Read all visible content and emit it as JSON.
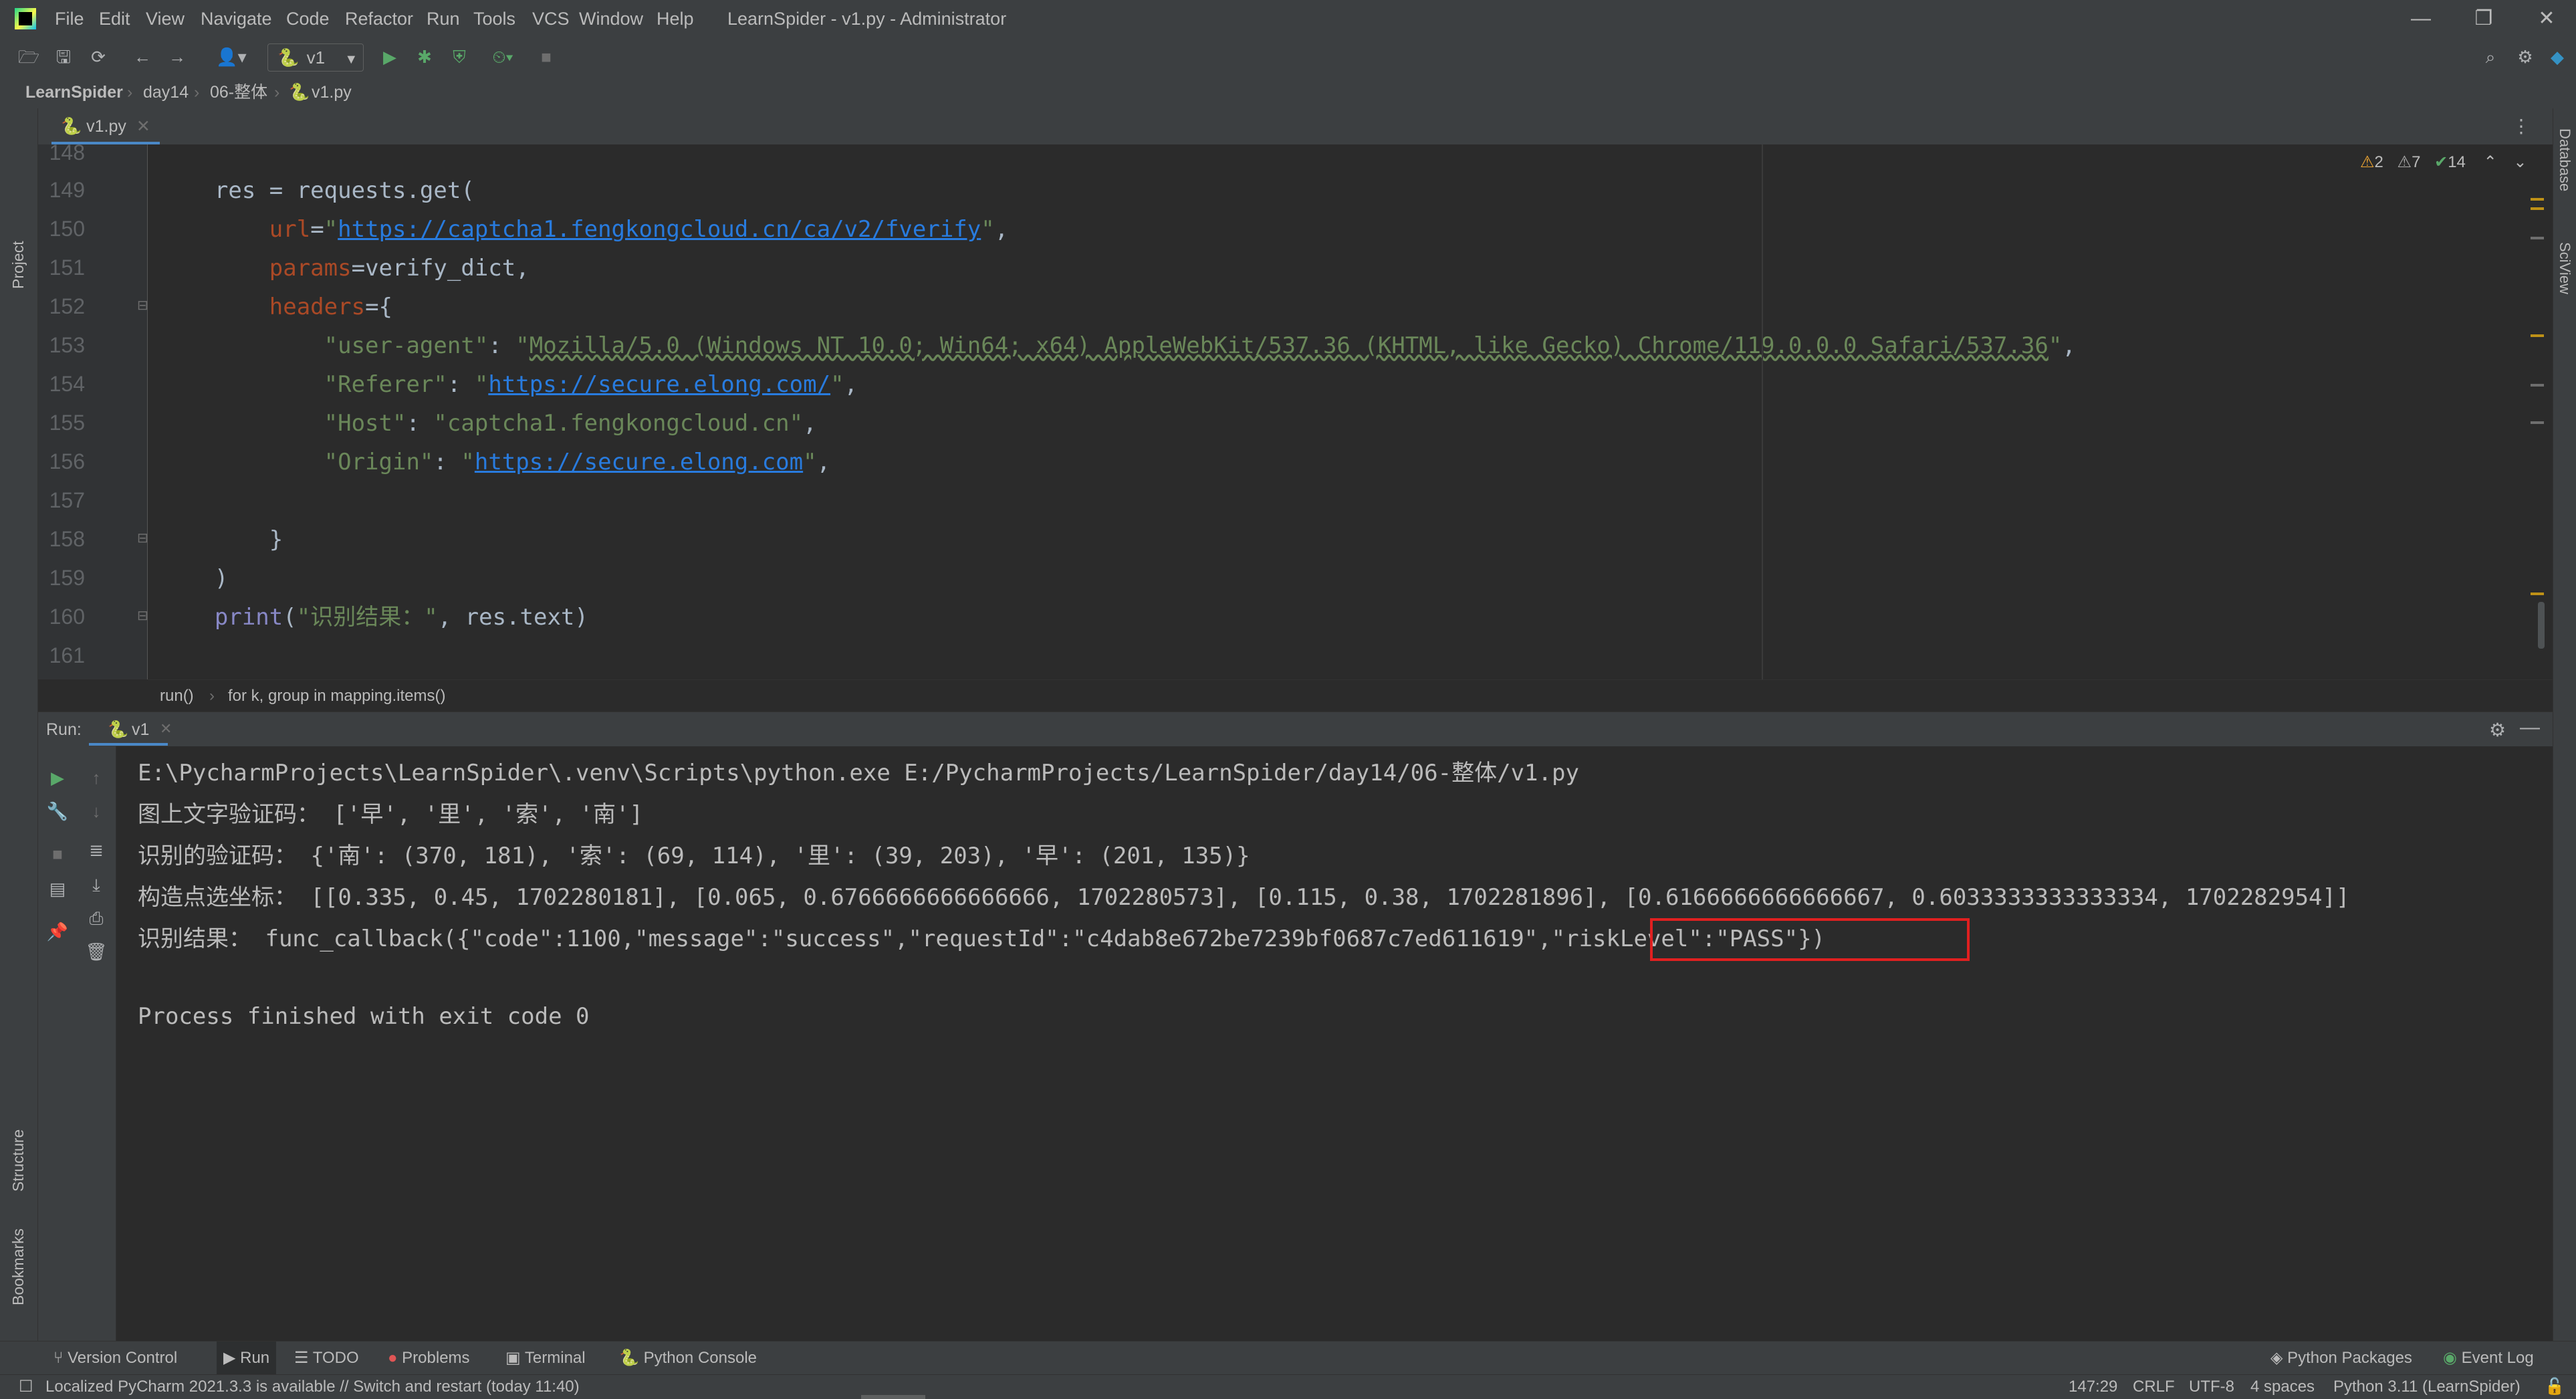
{
  "window": {
    "title": "LearnSpider - v1.py - Administrator",
    "menu": [
      "File",
      "Edit",
      "View",
      "Navigate",
      "Code",
      "Refactor",
      "Run",
      "Tools",
      "VCS",
      "Window",
      "Help"
    ],
    "controls": [
      "minimize-icon",
      "restore-icon",
      "close-icon"
    ]
  },
  "toolbar": {
    "run_config": "v1",
    "icons": [
      "open-icon",
      "save-icon",
      "sync-icon",
      "back-icon",
      "forward-icon",
      "user-icon",
      "run-icon",
      "debug-icon",
      "coverage-icon",
      "profile-icon",
      "stop-icon",
      "search-icon",
      "settings-icon",
      "update-icon"
    ]
  },
  "breadcrumb": [
    "LearnSpider",
    "day14",
    "06-整体",
    "v1.py"
  ],
  "left_tool_windows": [
    "Project",
    "Structure",
    "Bookmarks"
  ],
  "right_tool_windows": [
    "Database",
    "SciView"
  ],
  "editor": {
    "tab": "v1.py",
    "inspections": {
      "warnings": "2",
      "weak_warnings": "7",
      "typos": "14"
    },
    "line_numbers": [
      "148",
      "149",
      "150",
      "151",
      "152",
      "153",
      "154",
      "155",
      "156",
      "157",
      "158",
      "159",
      "160",
      "161"
    ],
    "lines": [
      "",
      "    res = requests.get(",
      "        url=\"https://captcha1.fengkongcloud.cn/ca/v2/fverify\",",
      "        params=verify_dict,",
      "        headers={",
      "            \"user-agent\": \"Mozilla/5.0 (Windows NT 10.0; Win64; x64) AppleWebKit/537.36 (KHTML, like Gecko) Chrome/119.0.0.0 Safari/537.36\",",
      "            \"Referer\": \"https://secure.elong.com/\",",
      "            \"Host\": \"captcha1.fengkongcloud.cn\",",
      "            \"Origin\": \"https://secure.elong.com\",",
      "",
      "        }",
      "    )",
      "    print(\"识别结果：\", res.text)",
      ""
    ],
    "code_breadcrumb": [
      "run()",
      "for k, group in mapping.items()"
    ]
  },
  "run_panel": {
    "label": "Run:",
    "tab": "v1",
    "output": [
      "E:\\PycharmProjects\\LearnSpider\\.venv\\Scripts\\python.exe E:/PycharmProjects/LearnSpider/day14/06-整体/v1.py",
      "图上文字验证码： ['早', '里', '索', '南']",
      "识别的验证码： {'南': (370, 181), '索': (69, 114), '里': (39, 203), '早': (201, 135)}",
      "构造点选坐标： [[0.335, 0.45, 1702280181], [0.065, 0.6766666666666666, 1702280573], [0.115, 0.38, 1702281896], [0.6166666666666667, 0.6033333333333334, 1702282954]]",
      "识别结果： func_callback({\"code\":1100,\"message\":\"success\",\"requestId\":\"c4dab8e672be7239bf0687c7ed611619\",\"riskLevel\":\"PASS\"})",
      "",
      "Process finished with exit code 0"
    ]
  },
  "tool_tabs": [
    "Version Control",
    "Run",
    "TODO",
    "Problems",
    "Terminal",
    "Python Console",
    "Python Packages",
    "Event Log"
  ],
  "status": {
    "message": "Localized PyCharm 2021.3.3 is available // Switch and restart (today 11:40)",
    "position": "147:29",
    "line_separator": "CRLF",
    "encoding": "UTF-8",
    "indent": "4 spaces",
    "interpreter": "Python 3.11 (LearnSpider)"
  }
}
